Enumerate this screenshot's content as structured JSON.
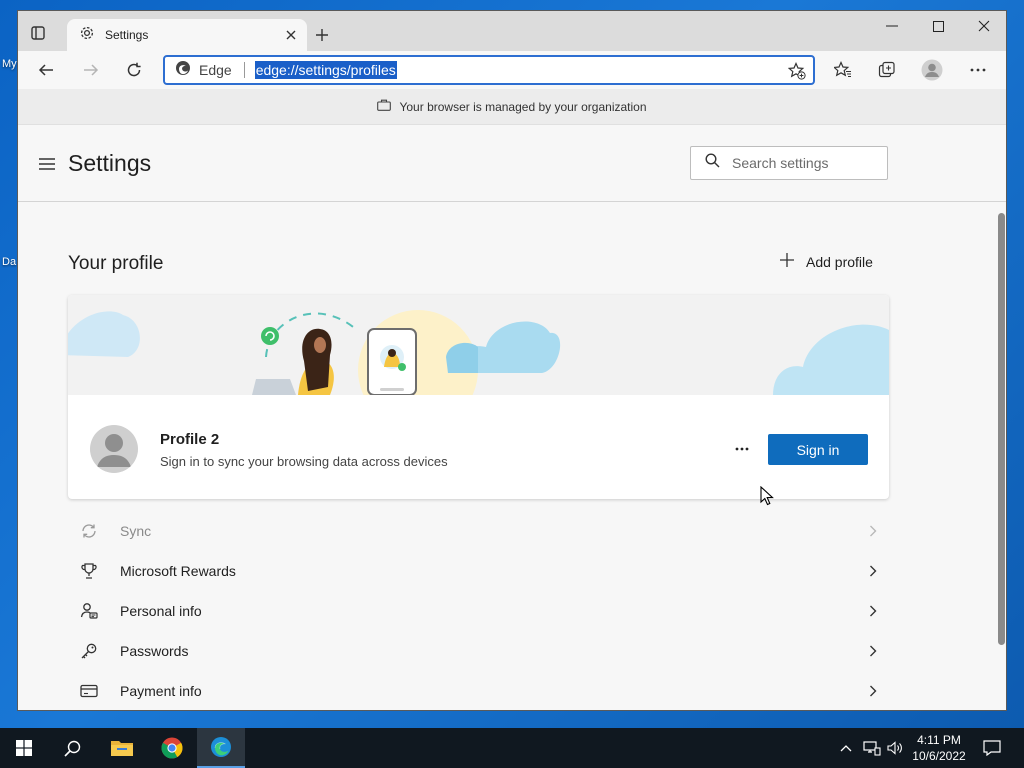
{
  "desktop": {
    "icon_labels": [
      "My",
      "Da"
    ]
  },
  "tab": {
    "title": "Settings"
  },
  "omnibox": {
    "site_label": "Edge",
    "url": "edge://settings/profiles"
  },
  "banner": {
    "managed_text": "Your browser is managed by your organization"
  },
  "settings": {
    "title": "Settings",
    "search_placeholder": "Search settings"
  },
  "profile": {
    "section_title": "Your profile",
    "add_profile_label": "Add profile",
    "name": "Profile 2",
    "subtitle": "Sign in to sync your browsing data across devices",
    "sign_in_label": "Sign in"
  },
  "menu": [
    {
      "label": "Sync",
      "icon": "sync-icon",
      "disabled": true
    },
    {
      "label": "Microsoft Rewards",
      "icon": "trophy-icon"
    },
    {
      "label": "Personal info",
      "icon": "personal-info-icon"
    },
    {
      "label": "Passwords",
      "icon": "key-icon"
    },
    {
      "label": "Payment info",
      "icon": "card-icon"
    }
  ],
  "taskbar": {
    "time": "4:11 PM",
    "date": "10/6/2022"
  },
  "colors": {
    "accent": "#0f6cbd",
    "url_highlight": "#1a5fc8",
    "taskbar": "#101820"
  }
}
